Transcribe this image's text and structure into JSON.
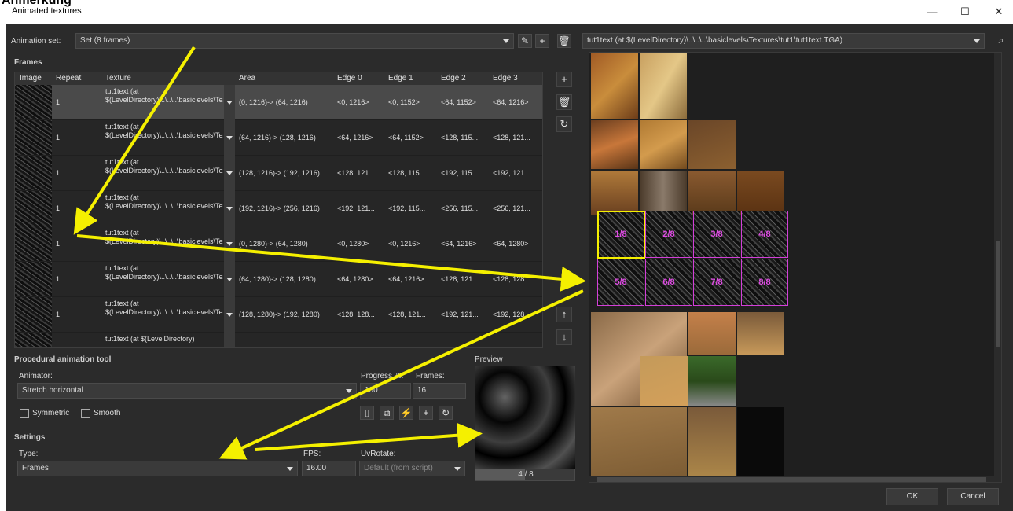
{
  "window": {
    "title": "Animated textures",
    "cropped_heading": "Anmerkung"
  },
  "animation_set": {
    "label": "Animation set:",
    "value": "Set (8 frames)"
  },
  "texture_path": "tut1text (at $(LevelDirectory)\\..\\..\\..\\basiclevels\\Textures\\tut1\\tut1text.TGA)",
  "frames": {
    "label": "Frames",
    "columns": [
      "Image",
      "Repeat",
      "Texture",
      "Area",
      "Edge 0",
      "Edge 1",
      "Edge 2",
      "Edge 3"
    ],
    "rows": [
      {
        "repeat": "1",
        "texture": "tut1text (at $(LevelDirectory)\\..\\..\\..\\basiclevels\\Textures\\tut1\\tut1text.TGA)",
        "area": "(0, 1216)-> (64, 1216)",
        "e0": "<0, 1216>",
        "e1": "<0, 1152>",
        "e2": "<64, 1152>",
        "e3": "<64, 1216>"
      },
      {
        "repeat": "1",
        "texture": "tut1text (at $(LevelDirectory)\\..\\..\\..\\basiclevels\\Textures\\tut1\\tut1text.TGA)",
        "area": "(64, 1216)-> (128, 1216)",
        "e0": "<64, 1216>",
        "e1": "<64, 1152>",
        "e2": "<128, 115...",
        "e3": "<128, 121..."
      },
      {
        "repeat": "1",
        "texture": "tut1text (at $(LevelDirectory)\\..\\..\\..\\basiclevels\\Textures\\tut1\\tut1text.TGA)",
        "area": "(128, 1216)-> (192, 1216)",
        "e0": "<128, 121...",
        "e1": "<128, 115...",
        "e2": "<192, 115...",
        "e3": "<192, 121..."
      },
      {
        "repeat": "1",
        "texture": "tut1text (at $(LevelDirectory)\\..\\..\\..\\basiclevels\\Textures\\tut1\\tut1text.TGA)",
        "area": "(192, 1216)-> (256, 1216)",
        "e0": "<192, 121...",
        "e1": "<192, 115...",
        "e2": "<256, 115...",
        "e3": "<256, 121..."
      },
      {
        "repeat": "1",
        "texture": "tut1text (at $(LevelDirectory)\\..\\..\\..\\basiclevels\\Textures\\tut1\\tut1text.TGA)",
        "area": "(0, 1280)-> (64, 1280)",
        "e0": "<0, 1280>",
        "e1": "<0, 1216>",
        "e2": "<64, 1216>",
        "e3": "<64, 1280>"
      },
      {
        "repeat": "1",
        "texture": "tut1text (at $(LevelDirectory)\\..\\..\\..\\basiclevels\\Textures\\tut1\\tut1text.TGA)",
        "area": "(64, 1280)-> (128, 1280)",
        "e0": "<64, 1280>",
        "e1": "<64, 1216>",
        "e2": "<128, 121...",
        "e3": "<128, 128..."
      },
      {
        "repeat": "1",
        "texture": "tut1text (at $(LevelDirectory)\\..\\..\\..\\basiclevels\\Textures\\tut1\\tut1text.TGA)",
        "area": "(128, 1280)-> (192, 1280)",
        "e0": "<128, 128...",
        "e1": "<128, 121...",
        "e2": "<192, 121...",
        "e3": "<192, 128..."
      },
      {
        "repeat": "",
        "texture": "tut1text (at $(LevelDirectory)",
        "area": "",
        "e0": "",
        "e1": "",
        "e2": "",
        "e3": ""
      }
    ]
  },
  "procedural": {
    "label": "Procedural animation tool",
    "animator_label": "Animator:",
    "animator_value": "Stretch horizontal",
    "progress_label": "Progress %:",
    "progress_value": "100",
    "frames_label": "Frames:",
    "frames_value": "16",
    "symmetric_label": "Symmetric",
    "smooth_label": "Smooth"
  },
  "settings": {
    "label": "Settings",
    "type_label": "Type:",
    "type_value": "Frames",
    "fps_label": "FPS:",
    "fps_value": "16.00",
    "uvrotate_label": "UvRotate:",
    "uvrotate_value": "Default (from script)"
  },
  "preview": {
    "label": "Preview",
    "progress_text": "4 / 8",
    "progress_fraction": 0.5
  },
  "texture_frames": [
    "1/8",
    "2/8",
    "3/8",
    "4/8",
    "5/8",
    "6/8",
    "7/8",
    "8/8"
  ],
  "buttons": {
    "ok": "OK",
    "cancel": "Cancel"
  },
  "colors": {
    "accent_frame": "#d33fd8",
    "annotation_arrow": "#f5f000",
    "selection": "#f5f000"
  }
}
